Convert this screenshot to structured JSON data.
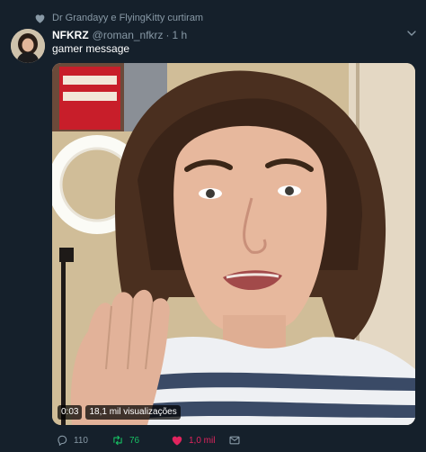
{
  "social_context": {
    "icon": "heart-icon",
    "text": "Dr Grandayy e FlyingKitty curtiram"
  },
  "author": {
    "name": "NFKRZ",
    "handle": "@roman_nfkrz",
    "separator": "·",
    "time": "1 h"
  },
  "tweet": {
    "text": "gamer message"
  },
  "video": {
    "duration": "0:03",
    "views": "18,1 mil visualizações"
  },
  "actions": {
    "reply_count": "110",
    "retweet_count": "76",
    "like_count": "1,0 mil"
  },
  "colors": {
    "background": "#15202b",
    "secondary_text": "#8899a6",
    "like_red": "#e0245e",
    "retweet_green": "#17bf63"
  }
}
